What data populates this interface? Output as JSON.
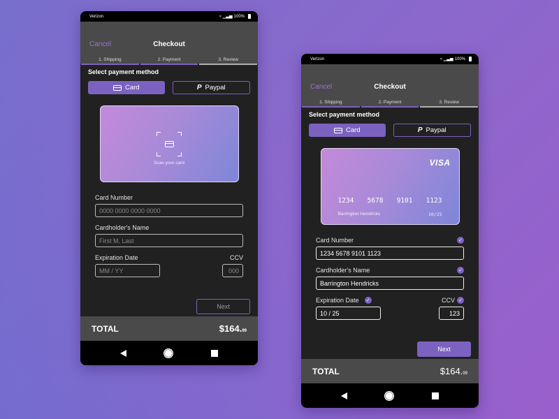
{
  "colors": {
    "accent": "#7c62c0",
    "cancel": "#9575cd",
    "surface": "#212121",
    "header": "#4a4a4a"
  },
  "phones": [
    {
      "status": {
        "carrier": "Verizon",
        "battery": "100%",
        "icons": [
          "wifi-icon",
          "signal-icon",
          "battery-icon"
        ]
      },
      "header": {
        "cancel": "Cancel",
        "title": "Checkout"
      },
      "steps": [
        {
          "label": "1. Shipping",
          "state": "done"
        },
        {
          "label": "2. Payment",
          "state": "current"
        },
        {
          "label": "3. Review",
          "state": "pending"
        }
      ],
      "section_title": "Select payment method",
      "methods": {
        "card": "Card",
        "paypal": "Paypal",
        "selected": "card"
      },
      "card_visual": {
        "scan_text": "Scan your card"
      },
      "form": {
        "card_number": {
          "label": "Card Number",
          "value": "",
          "placeholder": "0000  0000  0000  0000"
        },
        "name": {
          "label": "Cardholder's Name",
          "value": "",
          "placeholder": "First M. Last"
        },
        "expiration": {
          "label": "Expiration Date",
          "value": "",
          "placeholder": "MM / YY"
        },
        "ccv": {
          "label": "CCV",
          "value": "",
          "placeholder": "000"
        }
      },
      "next": {
        "label": "Next",
        "enabled": false
      },
      "total": {
        "label": "TOTAL",
        "dollars": "$164.",
        "cents": "99"
      }
    },
    {
      "status": {
        "carrier": "Verizon",
        "battery": "100%",
        "icons": [
          "wifi-icon",
          "signal-icon",
          "battery-icon"
        ]
      },
      "header": {
        "cancel": "Cancel",
        "title": "Checkout"
      },
      "steps": [
        {
          "label": "1. Shipping",
          "state": "done"
        },
        {
          "label": "2. Payment",
          "state": "current"
        },
        {
          "label": "3. Review",
          "state": "pending"
        }
      ],
      "section_title": "Select payment method",
      "methods": {
        "card": "Card",
        "paypal": "Paypal",
        "selected": "card"
      },
      "card_visual": {
        "brand": "VISA",
        "number_groups": [
          "1234",
          "5678",
          "9101",
          "1123"
        ],
        "holder": "Barrington Hendricks",
        "expiry": "10/25"
      },
      "form": {
        "card_number": {
          "label": "Card Number",
          "value": "1234  5678  9101  1123",
          "valid": true
        },
        "name": {
          "label": "Cardholder's Name",
          "value": "Barrington Hendricks",
          "valid": true
        },
        "expiration": {
          "label": "Expiration Date",
          "value": "10 / 25",
          "valid": true
        },
        "ccv": {
          "label": "CCV",
          "value": "123",
          "valid": true
        }
      },
      "next": {
        "label": "Next",
        "enabled": true
      },
      "total": {
        "label": "TOTAL",
        "dollars": "$164.",
        "cents": "99"
      },
      "check_glyph": "✓"
    }
  ]
}
